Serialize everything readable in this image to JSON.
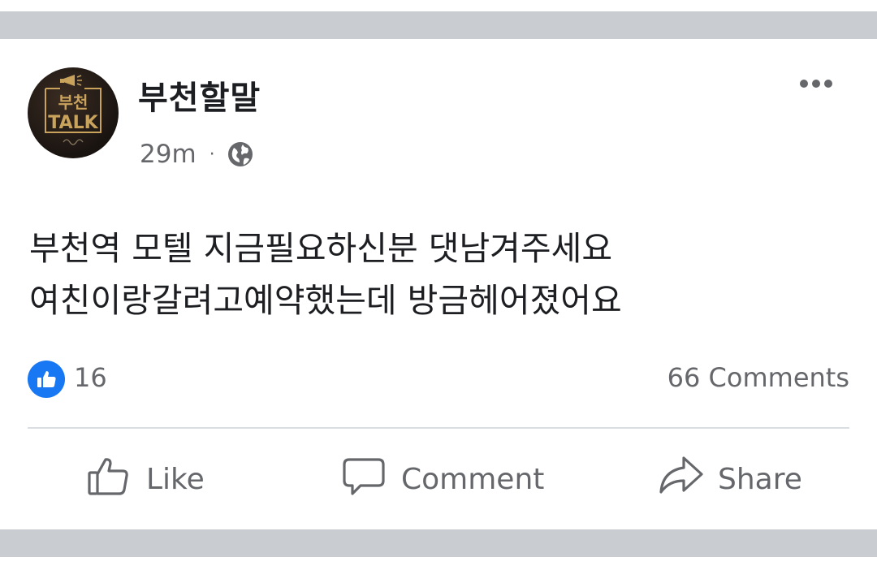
{
  "post": {
    "page_name": "부천할말",
    "avatar": {
      "line1": "부천",
      "line2": "TALK"
    },
    "timestamp": "29m",
    "separator": "·",
    "privacy_icon": "globe-icon",
    "more_icon": "more-options-icon",
    "text_lines": [
      "부천역 모텔 지금필요하신분 댓남겨주세요",
      "여친이랑갈려고예약했는데 방금헤어졌어요"
    ],
    "reactions": {
      "icon": "like-reaction-icon",
      "count": "16"
    },
    "comments_count": "66 Comments",
    "actions": {
      "like": {
        "label": "Like",
        "icon": "thumbs-up-icon"
      },
      "comment": {
        "label": "Comment",
        "icon": "comment-bubble-icon"
      },
      "share": {
        "label": "Share",
        "icon": "share-arrow-icon"
      }
    }
  },
  "colors": {
    "band": "#c9ccd1",
    "text_primary": "#1c1e21",
    "text_secondary": "#65676b",
    "like_blue": "#1877f2",
    "avatar_gold": "#c9a25c"
  }
}
